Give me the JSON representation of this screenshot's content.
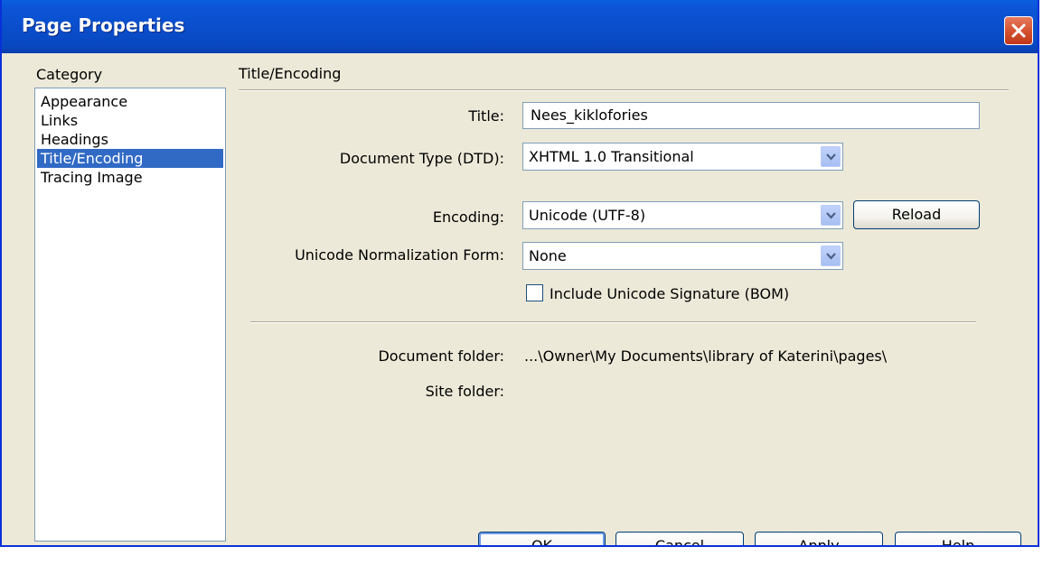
{
  "window": {
    "title": "Page Properties"
  },
  "category": {
    "label": "Category",
    "items": [
      "Appearance",
      "Links",
      "Headings",
      "Title/Encoding",
      "Tracing Image"
    ],
    "selected": "Title/Encoding"
  },
  "panel": {
    "heading": "Title/Encoding",
    "title_label": "Title:",
    "title_value": "Nees_kiklofories",
    "doctype_label": "Document Type (DTD):",
    "doctype_value": "XHTML 1.0 Transitional",
    "encoding_label": "Encoding:",
    "encoding_value": "Unicode (UTF-8)",
    "reload_label": "Reload",
    "normalization_label": "Unicode Normalization Form:",
    "normalization_value": "None",
    "bom_label": "Include Unicode Signature (BOM)",
    "bom_checked": false,
    "doc_folder_label": "Document folder:",
    "doc_folder_value": "...\\Owner\\My Documents\\library of Katerini\\pages\\",
    "site_folder_label": "Site folder:",
    "site_folder_value": ""
  },
  "buttons": {
    "ok": "OK",
    "cancel": "Cancel",
    "apply": "Apply",
    "help": "Help"
  },
  "colors": {
    "titlebar": "#0a4cc9",
    "selection": "#316ac5",
    "dialog_bg": "#ece9d8",
    "close_button": "#d24f2d"
  },
  "icons": {
    "close": "close-icon",
    "dropdown": "chevron-down-icon"
  }
}
